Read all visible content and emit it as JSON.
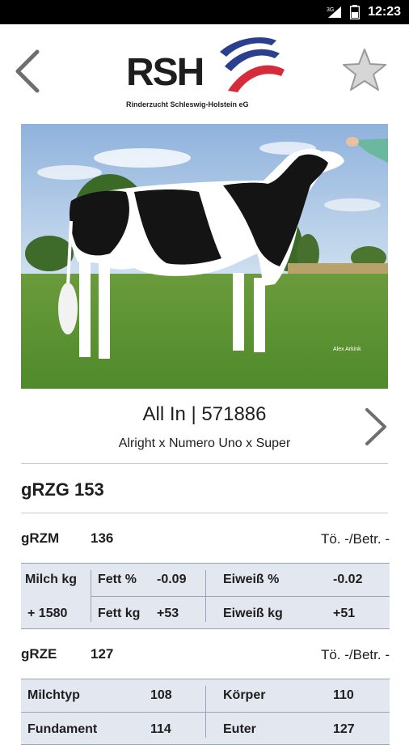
{
  "status_bar": {
    "network": "3G",
    "time": "12:23"
  },
  "header": {
    "logo_text": "RSH",
    "logo_subtitle": "Rinderzucht Schleswig-Holstein eG"
  },
  "photo": {
    "watermark": "Alex Arkink"
  },
  "animal": {
    "title": "All In | 571886",
    "pedigree": "Alright x Numero Uno x Super"
  },
  "rzg": {
    "label": "gRZG 153"
  },
  "rzm": {
    "label": "gRZM",
    "value": "136",
    "toe_betr": "Tö. -/Betr. -",
    "table": {
      "milch_label": "Milch kg",
      "milch_value": "+ 1580",
      "fett_pct_label": "Fett %",
      "fett_pct_value": "-0.09",
      "fett_kg_label": "Fett kg",
      "fett_kg_value": "+53",
      "eiweiss_pct_label": "Eiweiß %",
      "eiweiss_pct_value": "-0.02",
      "eiweiss_kg_label": "Eiweiß kg",
      "eiweiss_kg_value": "+51"
    }
  },
  "rze": {
    "label": "gRZE",
    "value": "127",
    "toe_betr": "Tö. -/Betr. -",
    "table": {
      "milchtyp_label": "Milchtyp",
      "milchtyp_value": "108",
      "koerper_label": "Körper",
      "koerper_value": "110",
      "fundament_label": "Fundament",
      "fundament_value": "114",
      "euter_label": "Euter",
      "euter_value": "127"
    }
  },
  "colors": {
    "table_bg": "#e3e7f0",
    "brand_blue": "#2b3f8f",
    "brand_red": "#d62b3a"
  }
}
